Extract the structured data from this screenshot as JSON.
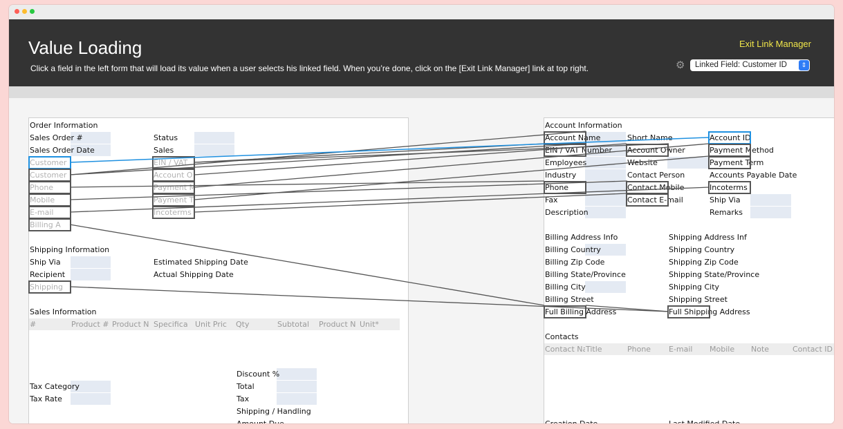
{
  "header": {
    "title": "Value Loading",
    "description": "Click a field in the left form that will load its value when a user selects his linked field. When you’re done, click on the [Exit Link Manager] link at top right.",
    "exit_link": "Exit Link Manager",
    "linked_field": "Linked Field: Customer ID",
    "gear_icon": "gear-icon",
    "dropdown_icon": "chevron-updown-icon"
  },
  "colors": {
    "accent_link": "#f0e64a",
    "active_link": "#1e90e0",
    "link_line": "#555555"
  },
  "left": {
    "order_title": "Order Information",
    "sales_order_no": "Sales Order #",
    "status": "Status",
    "sales_order_date": "Sales Order Date",
    "sales": "Sales",
    "customer1": "Customer",
    "ein_vat": "EIN / VAT",
    "customer2": "Customer",
    "account_o": "Account O",
    "phone": "Phone",
    "payment_m": "Payment M",
    "mobile": "Mobile",
    "payment_t": "Payment T",
    "email": "E-mail",
    "incoterms": "Incoterms",
    "billing_a": "Billing A",
    "shipping_title": "Shipping Information",
    "ship_via": "Ship Via",
    "est_ship_date": "Estimated Shipping Date",
    "recipient": "Recipient",
    "actual_ship_date": "Actual Shipping Date",
    "shipping": "Shipping",
    "sales_info_title": "Sales Information",
    "sales_cols": [
      "#",
      "Product #",
      "Product N",
      "Specifica",
      "Unit Pric",
      "Qty",
      "Subtotal",
      "Product N",
      "Unit*"
    ],
    "discount": "Discount %",
    "tax_category": "Tax Category",
    "total": "Total",
    "tax_rate": "Tax Rate",
    "tax": "Tax",
    "shipping_handling": "Shipping / Handling",
    "amount_due": "Amount Due"
  },
  "right": {
    "account_title": "Account Information",
    "account_name": "Account Name",
    "short_name": "Short Name",
    "account_id": "Account ID",
    "ein_vat_number": "EIN / VAT Number",
    "account_owner": "Account Owner",
    "payment_method": "Payment Method",
    "employees": "Employees",
    "website": "Website",
    "payment_term": "Payment Term",
    "industry": "Industry",
    "contact_person": "Contact Person",
    "accounts_payable_date": "Accounts Payable Date",
    "phone": "Phone",
    "contact_mobile": "Contact Mobile",
    "incoterms": "Incoterms",
    "fax": "Fax",
    "contact_email": "Contact E-mail",
    "ship_via": "Ship Via",
    "description": "Description",
    "remarks": "Remarks",
    "billing_address_info": "Billing Address Info",
    "shipping_address_inf": "Shipping Address Inf",
    "billing_country": "Billing Country",
    "shipping_country": "Shipping Country",
    "billing_zip": "Billing Zip Code",
    "shipping_zip": "Shipping Zip Code",
    "billing_state": "Billing State/Province",
    "shipping_state": "Shipping State/Province",
    "billing_city": "Billing City",
    "shipping_city": "Shipping City",
    "billing_street": "Billing Street",
    "shipping_street": "Shipping Street",
    "full_billing_address": "Full Billing Address",
    "full_shipping_address": "Full Shipping Address",
    "contacts_title": "Contacts",
    "contact_cols": [
      "Contact Na",
      "Title",
      "Phone",
      "E-mail",
      "Mobile",
      "Note",
      "Contact ID"
    ],
    "creation_date": "Creation Date",
    "last_modified_date": "Last Modified Date"
  }
}
